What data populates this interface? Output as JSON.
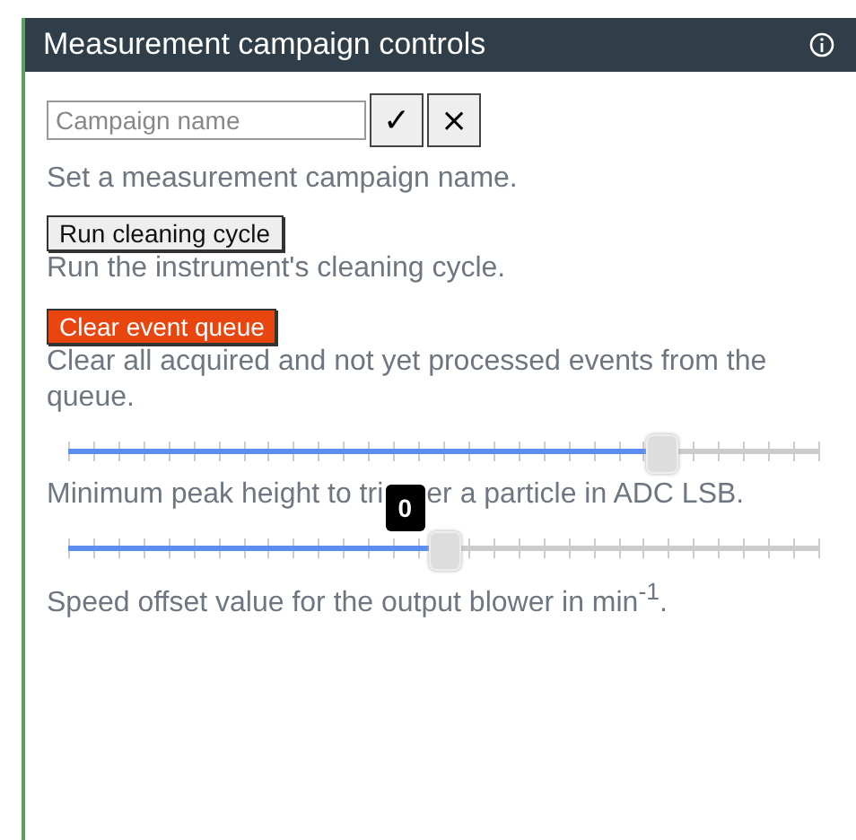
{
  "panel": {
    "title": "Measurement campaign controls"
  },
  "campaign": {
    "placeholder": "Campaign name",
    "confirm": "✓",
    "cancel": "×",
    "description": "Set a measurement campaign name."
  },
  "actions": [
    {
      "label": "Run cleaning cycle",
      "kind": "normal",
      "description": "Run the instrument's cleaning cycle."
    },
    {
      "label": "Clear event queue",
      "kind": "danger",
      "description": "Clear all acquired and not yet processed events from the queue."
    }
  ],
  "sliders": [
    {
      "level": 0.79,
      "description_parts": [
        "Minimum peak height to tri",
        "er a particle in ADC LSB."
      ]
    },
    {
      "level": 0.5,
      "tooltip": "0",
      "description": "Speed offset value for the output blower in min$^{-1}$."
    }
  ]
}
